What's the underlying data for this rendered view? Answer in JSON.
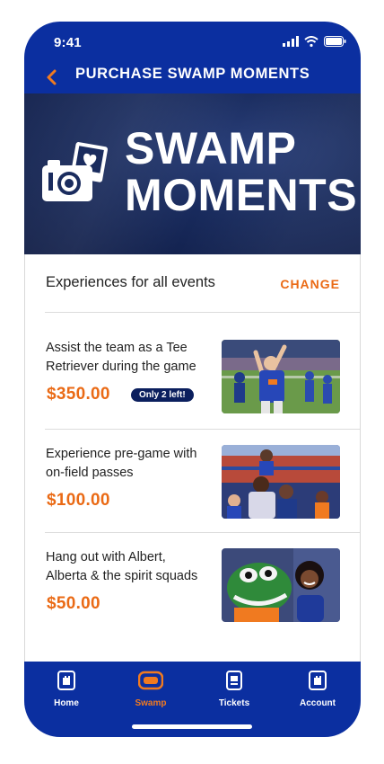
{
  "status_bar": {
    "time": "9:41"
  },
  "header": {
    "title": "PURCHASE SWAMP MOMENTS"
  },
  "hero": {
    "line1": "SWAMP",
    "line2": "MOMENTS"
  },
  "experiences": {
    "label": "Experiences for all events",
    "change_label": "CHANGE"
  },
  "items": [
    {
      "title": "Assist the team as a Tee Retriever during the game",
      "price": "$350.00",
      "badge": "Only 2 left!"
    },
    {
      "title": "Experience pre-game with on-field passes",
      "price": "$100.00"
    },
    {
      "title": "Hang out with Albert, Alberta & the spirit squads",
      "price": "$50.00"
    }
  ],
  "tabbar": {
    "tabs": [
      {
        "label": "Home",
        "icon": "home-icon"
      },
      {
        "label": "Swamp",
        "icon": "swamp-icon",
        "active": true
      },
      {
        "label": "Tickets",
        "icon": "tickets-icon"
      },
      {
        "label": "Account",
        "icon": "account-icon"
      }
    ]
  },
  "colors": {
    "primary_blue": "#0b2fa0",
    "accent_orange": "#ea6a15",
    "badge_navy": "#0b1f5e"
  }
}
